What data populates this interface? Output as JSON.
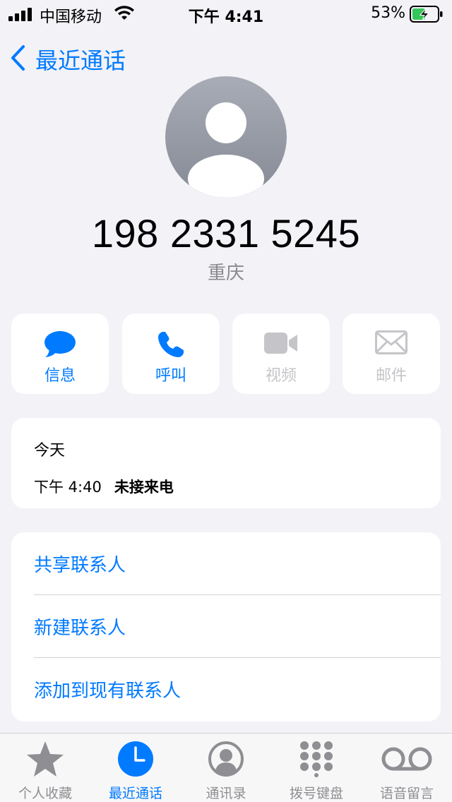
{
  "status_bar": {
    "carrier": "中国移动",
    "time": "下午 4:41",
    "battery_percent": "53%",
    "battery_level": 0.53,
    "charging": true
  },
  "nav": {
    "back_label": "最近通话"
  },
  "caller": {
    "number": "198 2331 5245",
    "location": "重庆"
  },
  "actions": [
    {
      "label": "信息",
      "icon": "message-icon",
      "enabled": true
    },
    {
      "label": "呼叫",
      "icon": "phone-icon",
      "enabled": true
    },
    {
      "label": "视频",
      "icon": "video-icon",
      "enabled": false
    },
    {
      "label": "邮件",
      "icon": "mail-icon",
      "enabled": false
    }
  ],
  "call_history": {
    "date": "今天",
    "time": "下午 4:40",
    "type": "未接来电"
  },
  "options": [
    {
      "label": "共享联系人"
    },
    {
      "label": "新建联系人"
    },
    {
      "label": "添加到现有联系人"
    }
  ],
  "tab_bar": {
    "tabs": [
      {
        "label": "个人收藏",
        "icon": "star-icon",
        "active": false
      },
      {
        "label": "最近通话",
        "icon": "clock-icon",
        "active": true
      },
      {
        "label": "通讯录",
        "icon": "person-circle-icon",
        "active": false
      },
      {
        "label": "拨号键盘",
        "icon": "keypad-icon",
        "active": false
      },
      {
        "label": "语音留言",
        "icon": "voicemail-icon",
        "active": false
      }
    ]
  },
  "colors": {
    "accent": "#007aff",
    "background": "#f2f2f7",
    "disabled": "#c5c5c9",
    "inactive_tab": "#8e8e93",
    "battery_charging": "#34c759"
  }
}
